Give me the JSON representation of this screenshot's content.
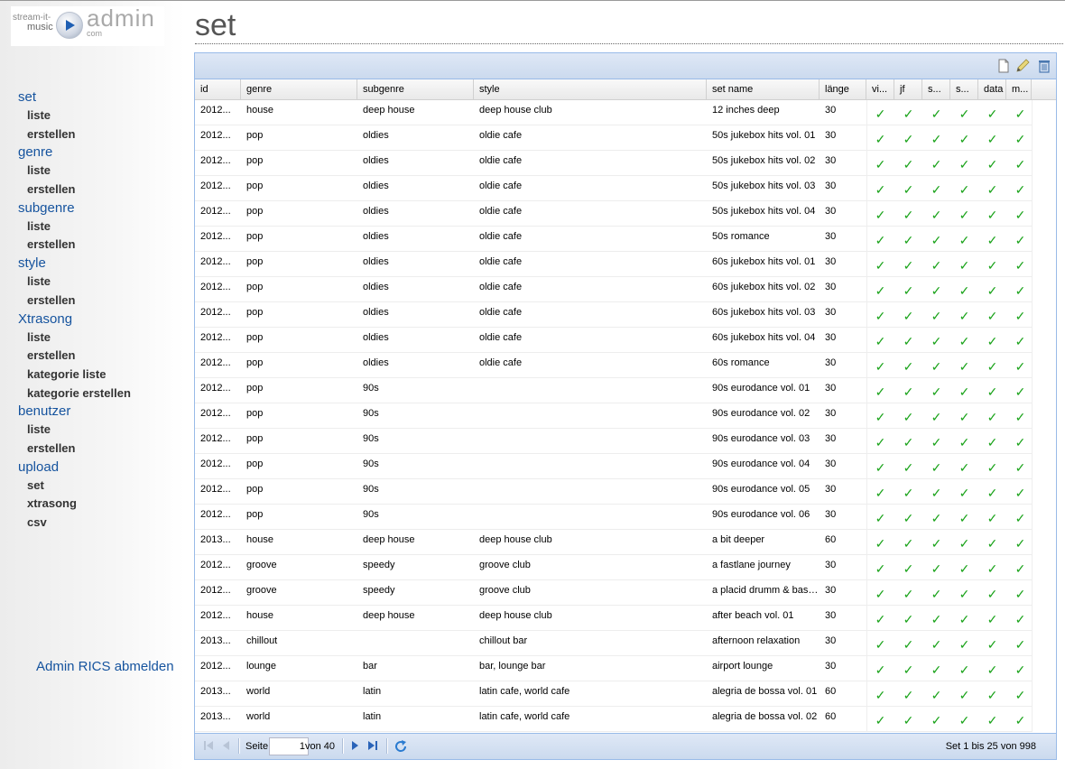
{
  "logo": {
    "stream": "stream-it-",
    "music": "music",
    "admin": "admin",
    "com": "com"
  },
  "page_title": "set",
  "nav": [
    {
      "label": "set",
      "items": [
        "liste",
        "erstellen"
      ]
    },
    {
      "label": "genre",
      "items": [
        "liste",
        "erstellen"
      ]
    },
    {
      "label": "subgenre",
      "items": [
        "liste",
        "erstellen"
      ]
    },
    {
      "label": "style",
      "items": [
        "liste",
        "erstellen"
      ]
    },
    {
      "label": "Xtrasong",
      "items": [
        "liste",
        "erstellen",
        "kategorie liste",
        "kategorie erstellen"
      ]
    },
    {
      "label": "benutzer",
      "items": [
        "liste",
        "erstellen"
      ]
    },
    {
      "label": "upload",
      "items": [
        "set",
        "xtrasong",
        "csv"
      ]
    }
  ],
  "logout": "Admin RICS abmelden",
  "toolbar": {
    "icons": [
      "new-document-icon",
      "edit-pencil-icon",
      "delete-trash-icon"
    ]
  },
  "columns": [
    "id",
    "genre",
    "subgenre",
    "style",
    "set name",
    "länge",
    "vi...",
    "jf",
    "s...",
    "s...",
    "data",
    "m..."
  ],
  "check_mark": "✓",
  "rows": [
    [
      "2012...",
      "house",
      "deep house",
      "deep house club",
      "12 inches deep",
      "30"
    ],
    [
      "2012...",
      "pop",
      "oldies",
      "oldie cafe",
      "50s jukebox hits vol. 01",
      "30"
    ],
    [
      "2012...",
      "pop",
      "oldies",
      "oldie cafe",
      "50s jukebox hits vol. 02",
      "30"
    ],
    [
      "2012...",
      "pop",
      "oldies",
      "oldie cafe",
      "50s jukebox hits vol. 03",
      "30"
    ],
    [
      "2012...",
      "pop",
      "oldies",
      "oldie cafe",
      "50s jukebox hits vol. 04",
      "30"
    ],
    [
      "2012...",
      "pop",
      "oldies",
      "oldie cafe",
      "50s romance",
      "30"
    ],
    [
      "2012...",
      "pop",
      "oldies",
      "oldie cafe",
      "60s jukebox hits vol. 01",
      "30"
    ],
    [
      "2012...",
      "pop",
      "oldies",
      "oldie cafe",
      "60s jukebox hits vol. 02",
      "30"
    ],
    [
      "2012...",
      "pop",
      "oldies",
      "oldie cafe",
      "60s jukebox hits vol. 03",
      "30"
    ],
    [
      "2012...",
      "pop",
      "oldies",
      "oldie cafe",
      "60s jukebox hits vol. 04",
      "30"
    ],
    [
      "2012...",
      "pop",
      "oldies",
      "oldie cafe",
      "60s romance",
      "30"
    ],
    [
      "2012...",
      "pop",
      "90s",
      "",
      "90s eurodance vol. 01",
      "30"
    ],
    [
      "2012...",
      "pop",
      "90s",
      "",
      "90s eurodance vol. 02",
      "30"
    ],
    [
      "2012...",
      "pop",
      "90s",
      "",
      "90s eurodance vol. 03",
      "30"
    ],
    [
      "2012...",
      "pop",
      "90s",
      "",
      "90s eurodance vol. 04",
      "30"
    ],
    [
      "2012...",
      "pop",
      "90s",
      "",
      "90s eurodance vol. 05",
      "30"
    ],
    [
      "2012...",
      "pop",
      "90s",
      "",
      "90s eurodance vol. 06",
      "30"
    ],
    [
      "2013...",
      "house",
      "deep house",
      "deep house club",
      "a bit deeper",
      "60"
    ],
    [
      "2012...",
      "groove",
      "speedy",
      "groove club",
      "a fastlane journey",
      "30"
    ],
    [
      "2012...",
      "groove",
      "speedy",
      "groove club",
      "a placid drumm & bass...",
      "30"
    ],
    [
      "2012...",
      "house",
      "deep house",
      "deep house club",
      "after beach vol. 01",
      "30"
    ],
    [
      "2013...",
      "chillout",
      "",
      "chillout bar",
      "afternoon relaxation",
      "30"
    ],
    [
      "2012...",
      "lounge",
      "bar",
      "bar, lounge bar",
      "airport lounge",
      "30"
    ],
    [
      "2013...",
      "world",
      "latin",
      "latin cafe, world cafe",
      "alegria de bossa vol. 01",
      "60"
    ],
    [
      "2013...",
      "world",
      "latin",
      "latin cafe, world cafe",
      "alegria de bossa vol. 02",
      "60"
    ]
  ],
  "pager": {
    "page_label": "Seite",
    "page_value": "1",
    "of_label": "von 40",
    "summary": "Set 1 bis 25 von 998",
    "icons": [
      "first-page-icon",
      "prev-page-icon",
      "next-page-icon",
      "last-page-icon",
      "refresh-icon"
    ]
  },
  "colors": {
    "nav_link": "#15539e",
    "check": "#1aa31a",
    "grid_border": "#99bbe8"
  }
}
